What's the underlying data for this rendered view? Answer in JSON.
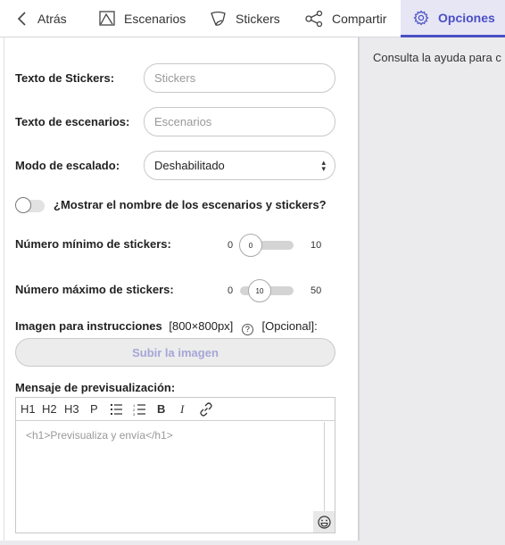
{
  "tabs": [
    {
      "label": "Atrás",
      "icon": "chevron-left-icon"
    },
    {
      "label": "Escenarios",
      "icon": "scene-icon"
    },
    {
      "label": "Stickers",
      "icon": "sticker-icon"
    },
    {
      "label": "Compartir",
      "icon": "share-icon"
    },
    {
      "label": "Opciones",
      "icon": "gear-icon",
      "active": true
    }
  ],
  "form": {
    "stickers_text_label": "Texto de Stickers:",
    "stickers_text_placeholder": "Stickers",
    "scenarios_text_label": "Texto de escenarios:",
    "scenarios_text_placeholder": "Escenarios",
    "scale_mode_label": "Modo de escalado:",
    "scale_mode_value": "Deshabilitado",
    "show_names_label": "¿Mostrar el nombre de los escenarios y stickers?",
    "show_names_on": false,
    "min_stickers_label": "Número mínimo de stickers:",
    "min_stickers": {
      "min": "0",
      "value": "0",
      "max": "10"
    },
    "max_stickers_label": "Número máximo de stickers:",
    "max_stickers": {
      "min": "0",
      "value": "10",
      "max": "50"
    },
    "image_label_bold": "Imagen para instrucciones",
    "image_size": "[800×800px]",
    "image_optional": "[Opcional]:",
    "upload_button": "Subir la imagen",
    "preview_label": "Mensaje de previsualización:",
    "editor_toolbar": [
      "H1",
      "H2",
      "H3",
      "P"
    ],
    "editor_placeholder": "<h1>Previsualiza y envía</h1>"
  },
  "help_text": "Consulta la ayuda para c",
  "colors": {
    "accent": "#4a4fc4",
    "active_tab_bg": "#e6e6f5"
  }
}
